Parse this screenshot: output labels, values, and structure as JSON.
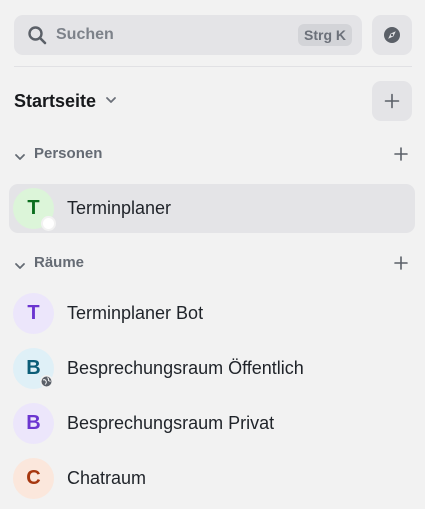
{
  "search": {
    "placeholder": "Suchen",
    "shortcut": "Strg K"
  },
  "space": {
    "title": "Startseite"
  },
  "sections": {
    "people": {
      "label": "Personen",
      "items": [
        {
          "initial": "T",
          "name": "Terminplaner",
          "avatar_bg": "#dcf5d9",
          "avatar_fg": "#0b6e1e"
        }
      ]
    },
    "rooms": {
      "label": "Räume",
      "items": [
        {
          "initial": "T",
          "name": "Terminplaner Bot",
          "avatar_bg": "#ece6fb",
          "avatar_fg": "#6b35d0"
        },
        {
          "initial": "B",
          "name": "Besprechungsraum Öffentlich",
          "avatar_bg": "#dff0f7",
          "avatar_fg": "#0b5d77"
        },
        {
          "initial": "B",
          "name": "Besprechungsraum Privat",
          "avatar_bg": "#ece6fb",
          "avatar_fg": "#6b35d0"
        },
        {
          "initial": "C",
          "name": "Chatraum",
          "avatar_bg": "#fbe7dc",
          "avatar_fg": "#a6370f"
        }
      ]
    }
  },
  "icons": {
    "search": "search-icon",
    "explore": "compass-icon",
    "chevron": "chevron-down-icon",
    "add": "plus-icon",
    "public": "globe-icon"
  }
}
